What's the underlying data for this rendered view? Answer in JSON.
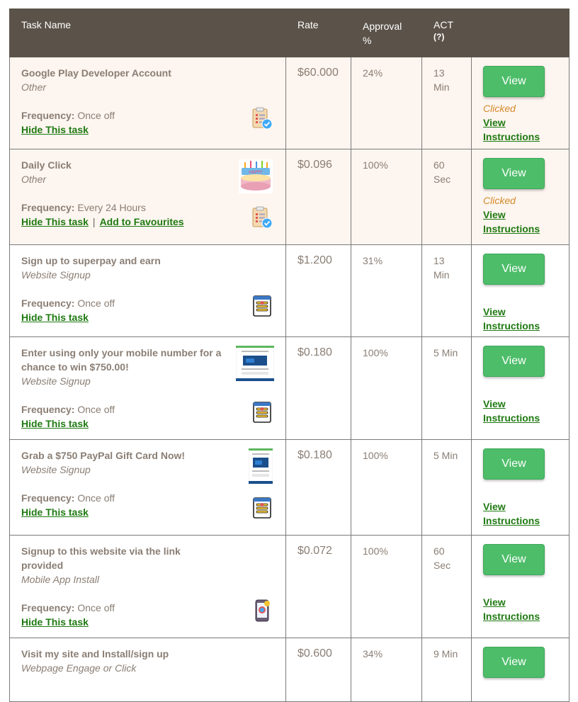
{
  "header": {
    "task_name": "Task Name",
    "rate": "Rate",
    "approval": "Approval %",
    "act": "ACT",
    "act_help": "(?)"
  },
  "tasks": [
    {
      "title": "Google Play Developer Account",
      "category": "Other",
      "frequency_label": "Frequency:",
      "frequency": "Once off",
      "hide_label": "Hide This task",
      "rate": "$60.000",
      "approval": "24%",
      "act_value": "13",
      "act_unit": "Min",
      "view_label": "View",
      "clicked": "Clicked",
      "instructions": "View Instructions",
      "icon": "clipboard-check-icon"
    },
    {
      "title": "Daily Click",
      "category": "Other",
      "frequency_label": "Frequency:",
      "frequency": "Every 24 Hours",
      "hide_label": "Hide This task",
      "fav_label": "Add to Favourites",
      "rate": "$0.096",
      "approval": "100%",
      "act_value": "60",
      "act_unit": "Sec",
      "view_label": "View",
      "clicked": "Clicked",
      "instructions": "View Instructions",
      "icon": "clipboard-check-icon"
    },
    {
      "title": "Sign up to superpay and earn",
      "category": "Website Signup",
      "frequency_label": "Frequency:",
      "frequency": "Once off",
      "hide_label": "Hide This task",
      "rate": "$1.200",
      "approval": "31%",
      "act_value": "13",
      "act_unit": "Min",
      "view_label": "View",
      "instructions": "View Instructions",
      "icon": "signup-form-icon"
    },
    {
      "title": "Enter using only your mobile number for a chance to win $750.00!",
      "category": "Website Signup",
      "frequency_label": "Frequency:",
      "frequency": "Once off",
      "hide_label": "Hide This task",
      "rate": "$0.180",
      "approval": "100%",
      "act_value": "5 Min",
      "act_unit": "",
      "view_label": "View",
      "instructions": "View Instructions",
      "icon": "signup-form-icon"
    },
    {
      "title": "Grab a $750 PayPal Gift Card Now!",
      "category": "Website Signup",
      "frequency_label": "Frequency:",
      "frequency": "Once off",
      "hide_label": "Hide This task",
      "rate": "$0.180",
      "approval": "100%",
      "act_value": "5 Min",
      "act_unit": "",
      "view_label": "View",
      "instructions": "View Instructions",
      "icon": "signup-form-icon"
    },
    {
      "title": "Signup to this website via the link provided",
      "category": "Mobile App Install",
      "frequency_label": "Frequency:",
      "frequency": "Once off",
      "hide_label": "Hide This task",
      "rate": "$0.072",
      "approval": "100%",
      "act_value": "60",
      "act_unit": "Sec",
      "view_label": "View",
      "instructions": "View Instructions",
      "icon": "mobile-app-icon"
    },
    {
      "title": "Visit my site and Install/sign up",
      "category": "Webpage Engage or Click",
      "rate": "$0.600",
      "approval": "34%",
      "act_value": "9 Min",
      "act_unit": "",
      "view_label": "View"
    }
  ],
  "colors": {
    "header_bg": "#5b5349",
    "highlight_row_bg": "#fdf5ef",
    "view_button": "#4dbd69",
    "link_green": "#1f7a12",
    "clicked_orange": "#d48a2a"
  }
}
